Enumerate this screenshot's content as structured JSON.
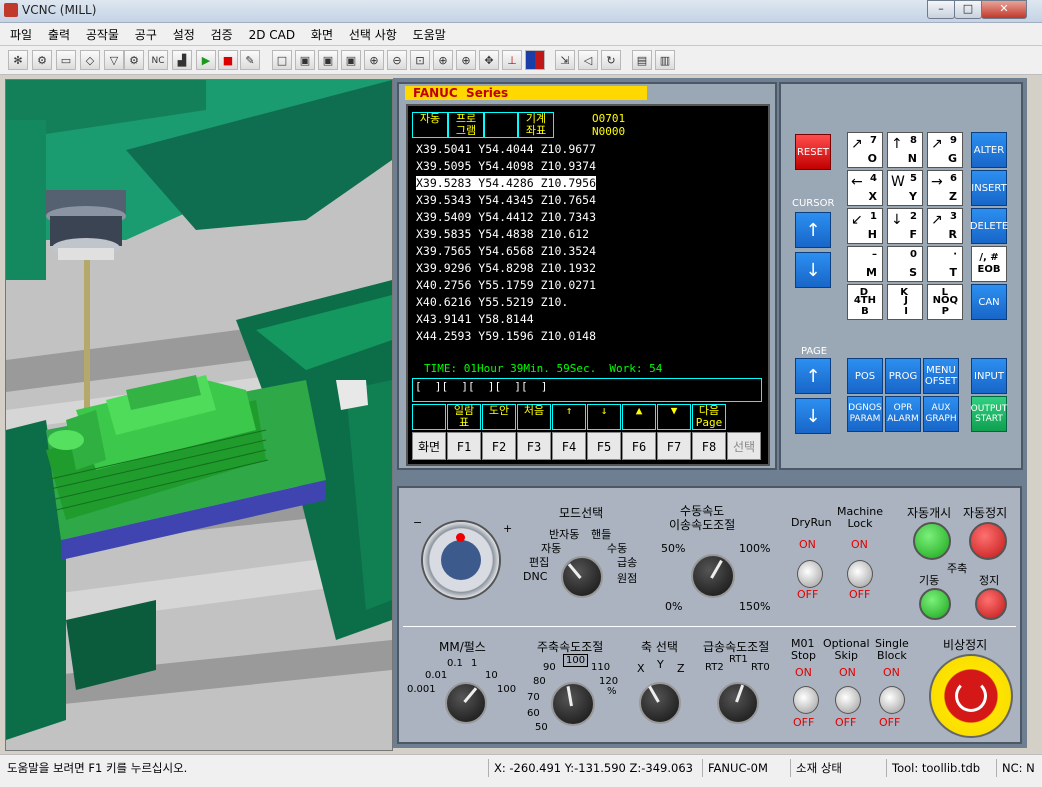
{
  "window": {
    "title": "VCNC (MILL)",
    "min": "–",
    "max": "□",
    "close": "✕"
  },
  "menu": [
    "파일",
    "출력",
    "공작물",
    "공구",
    "설정",
    "검증",
    "2D CAD",
    "화면",
    "선택 사항",
    "도움말"
  ],
  "screen": {
    "header": "FANUC  Series",
    "head_cells": [
      "자동",
      "프로\n그램",
      "",
      "기계\n좌표"
    ],
    "program": "O0701",
    "sequence": "N0000",
    "lines": [
      "X39.5041 Y54.4044 Z10.9677",
      "X39.5095 Y54.4098 Z10.9374",
      "X39.5283 Y54.4286 Z10.7956",
      "X39.5343 Y54.4345 Z10.7654",
      "X39.5409 Y54.4412 Z10.7343",
      "X39.5835 Y54.4838 Z10.612",
      "X39.7565 Y54.6568 Z10.3524",
      "X39.9296 Y54.8298 Z10.1932",
      "X40.2756 Y55.1759 Z10.0271",
      "X40.6216 Y55.5219 Z10.",
      "X43.9141 Y58.8144",
      "X44.2593 Y59.1596 Z10.0148"
    ],
    "highlight_index": 2,
    "time_line": "TIME: 01Hour 39Min. 59Sec.  Work: 54",
    "input_line": "[  ][  ][  ][  ][  ]",
    "softkeys": [
      "",
      "일람\n표",
      "도안",
      "처음",
      "↑",
      "↓",
      "▲",
      "▼",
      "다음\nPage"
    ],
    "fkeys": [
      "화면",
      "F1",
      "F2",
      "F3",
      "F4",
      "F5",
      "F6",
      "F7",
      "F8",
      "선택"
    ]
  },
  "keypad": {
    "reset": "RESET",
    "cursor_label": "CURSOR",
    "page_label": "PAGE",
    "up": "↑",
    "down": "↓",
    "white_keys": [
      {
        "a": "↗",
        "b": "7",
        "c": "O"
      },
      {
        "a": "↑",
        "b": "8",
        "c": "N"
      },
      {
        "a": "↗",
        "b": "9",
        "c": "G"
      },
      {
        "a": "←",
        "b": "4",
        "c": "X"
      },
      {
        "a": "W",
        "b": "5",
        "c": "Y"
      },
      {
        "a": "→",
        "b": "6",
        "c": "Z"
      },
      {
        "a": "↙",
        "b": "1",
        "c": "H"
      },
      {
        "a": "↓",
        "b": "2",
        "c": "F"
      },
      {
        "a": "↗",
        "b": "3",
        "c": "R"
      },
      {
        "a": "",
        "b": "–",
        "c": "M"
      },
      {
        "a": "",
        "b": "0",
        "c": "S"
      },
      {
        "a": "",
        "b": "·",
        "c": "T"
      },
      {
        "a": "",
        "b": "D",
        "c": "4TH\nB"
      },
      {
        "a": "",
        "b": "K",
        "c": "J\nI"
      },
      {
        "a": "",
        "b": "L",
        "c": "NOQ\nP"
      }
    ],
    "eob": "/, #\nEOB",
    "right_keys": [
      "ALTER",
      "INSERT",
      "DELETE"
    ],
    "can": "CAN",
    "bottom_keys": [
      "POS",
      "PROG",
      "MENU\nOFSET",
      "INPUT",
      "DGNOS\nPARAM",
      "OPR\nALARM",
      "AUX\nGRAPH"
    ],
    "output": "OUTPUT\nSTART"
  },
  "op": {
    "mode_title": "모드선택",
    "mode_labels": [
      "반자동",
      "핸들",
      "자동",
      "수동",
      "편집",
      "급송",
      "DNC",
      "원점"
    ],
    "jog_title": "수동속도\n이송속도조절",
    "jog_min": "0%",
    "jog_50": "50%",
    "jog_100": "100%",
    "jog_max": "150%",
    "dryrun": "DryRun",
    "machine_lock": "Machine\nLock",
    "on": "ON",
    "off": "OFF",
    "cycle_start": "자동개시",
    "cycle_stop": "자동정지",
    "spindle": "주축",
    "spindle_start": "기동",
    "spindle_stop": "정지",
    "mm_title": "MM/펄스",
    "mm_labels": [
      "0.1",
      "1",
      "10",
      "100",
      "0.001",
      "0.01"
    ],
    "spindle_speed": "주축속도조절",
    "ss_labels": [
      "100",
      "90",
      "110",
      "80",
      "120",
      "70",
      "%",
      "60",
      "50"
    ],
    "axis_title": "축 선택",
    "axis_labels": [
      "X",
      "Y",
      "Z"
    ],
    "rapid_title": "급송속도조절",
    "rapid_labels": [
      "RT1",
      "RT2",
      "RT0"
    ],
    "m01": "M01\nStop",
    "optional": "Optional\nSkip",
    "single": "Single\nBlock",
    "estop": "비상정지"
  },
  "status": {
    "help": "도움말을 보려면 F1 키를 누르십시오.",
    "coords": "X: -260.491  Y:-131.590  Z:-349.063",
    "control": "FANUC-0M",
    "material": "소재 상태",
    "tool": "Tool: toollib.tdb",
    "nc": "NC: N"
  }
}
